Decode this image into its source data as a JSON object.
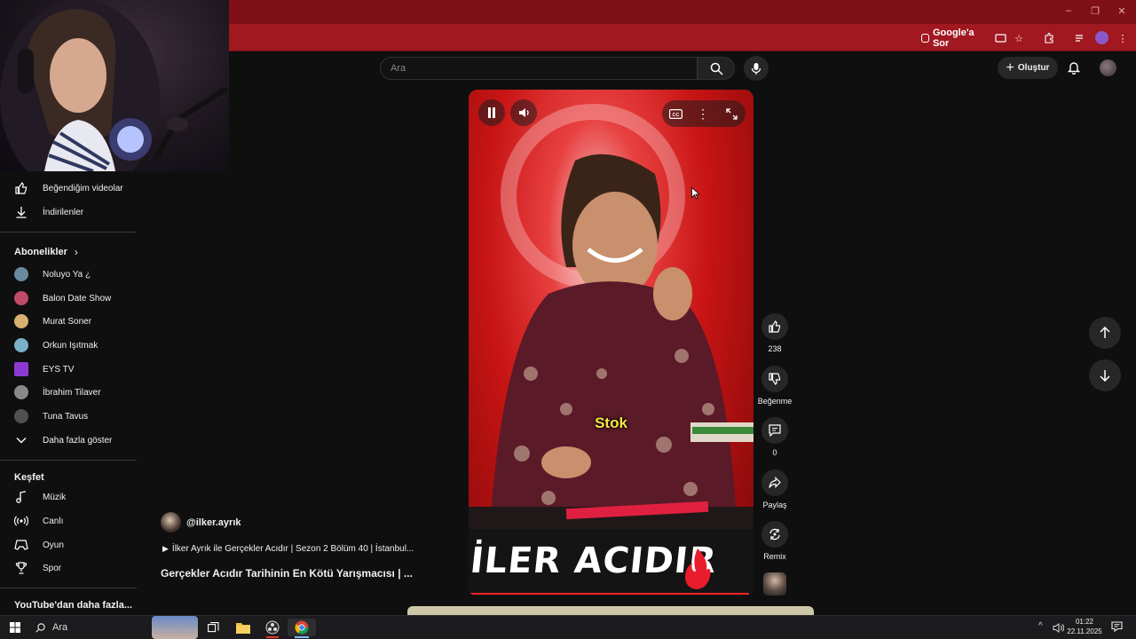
{
  "browser": {
    "google_ask_label": "Google'a Sor"
  },
  "youtube": {
    "search_placeholder": "Ara",
    "create_label": "Oluştur"
  },
  "sidebar": {
    "you_items": [
      {
        "label": "Beğendiğim videolar",
        "icon": "like-icon"
      },
      {
        "label": "İndirilenler",
        "icon": "download-icon"
      }
    ],
    "subscriptions_title": "Abonelikler",
    "subscriptions": [
      {
        "label": "Noluyo Ya ¿",
        "color": "#6a8aa0"
      },
      {
        "label": "Balon Date Show",
        "color": "#c04a6a"
      },
      {
        "label": "Murat Soner",
        "color": "#d8b070"
      },
      {
        "label": "Orkun Işıtmak",
        "color": "#7ab0c8"
      },
      {
        "label": "EYS TV",
        "color": "#8a3ad0"
      },
      {
        "label": "İbrahim Tilaver",
        "color": "#8a8a8a"
      },
      {
        "label": "Tuna Tavus",
        "color": "#505050"
      }
    ],
    "show_more_label": "Daha fazla göster",
    "explore_title": "Keşfet",
    "explore": [
      {
        "label": "Müzik",
        "icon": "music-icon"
      },
      {
        "label": "Canlı",
        "icon": "live-icon"
      },
      {
        "label": "Oyun",
        "icon": "gaming-icon"
      },
      {
        "label": "Spor",
        "icon": "trophy-icon"
      }
    ],
    "more_from_youtube": "YouTube'dan daha fazla..."
  },
  "video": {
    "subtitle": "Stok",
    "banner_text": "İLER ACIDIR",
    "channel_handle": "@ilker.ayrık",
    "playlist_line": "İlker Ayrık ile Gerçekler Acıdır | Sezon 2 Bölüm 40 | İstanbul...",
    "title": "Gerçekler Acıdır Tarihinin En Kötü Yarışmacısı | ..."
  },
  "actions": {
    "like_count": "238",
    "dislike_label": "Beğenme",
    "comment_count": "0",
    "share_label": "Paylaş",
    "remix_label": "Remix"
  },
  "taskbar": {
    "search_label": "Ara",
    "time": "01:22",
    "date": "22.11.2025"
  },
  "colors": {
    "browser_frame": "#7f1018",
    "browser_toolbar": "#a11820",
    "youtube_bg": "#0f0f0f",
    "subtitle_yellow": "#f5e642"
  }
}
